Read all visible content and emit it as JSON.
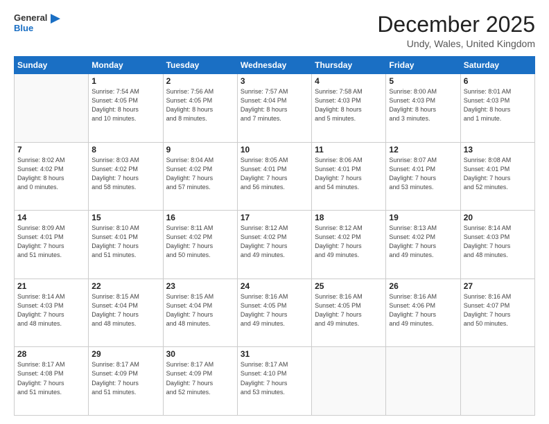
{
  "logo": {
    "line1": "General",
    "line2": "Blue"
  },
  "header": {
    "month": "December 2025",
    "location": "Undy, Wales, United Kingdom"
  },
  "weekdays": [
    "Sunday",
    "Monday",
    "Tuesday",
    "Wednesday",
    "Thursday",
    "Friday",
    "Saturday"
  ],
  "weeks": [
    [
      {
        "day": "",
        "info": ""
      },
      {
        "day": "1",
        "info": "Sunrise: 7:54 AM\nSunset: 4:05 PM\nDaylight: 8 hours\nand 10 minutes."
      },
      {
        "day": "2",
        "info": "Sunrise: 7:56 AM\nSunset: 4:05 PM\nDaylight: 8 hours\nand 8 minutes."
      },
      {
        "day": "3",
        "info": "Sunrise: 7:57 AM\nSunset: 4:04 PM\nDaylight: 8 hours\nand 7 minutes."
      },
      {
        "day": "4",
        "info": "Sunrise: 7:58 AM\nSunset: 4:03 PM\nDaylight: 8 hours\nand 5 minutes."
      },
      {
        "day": "5",
        "info": "Sunrise: 8:00 AM\nSunset: 4:03 PM\nDaylight: 8 hours\nand 3 minutes."
      },
      {
        "day": "6",
        "info": "Sunrise: 8:01 AM\nSunset: 4:03 PM\nDaylight: 8 hours\nand 1 minute."
      }
    ],
    [
      {
        "day": "7",
        "info": "Sunrise: 8:02 AM\nSunset: 4:02 PM\nDaylight: 8 hours\nand 0 minutes."
      },
      {
        "day": "8",
        "info": "Sunrise: 8:03 AM\nSunset: 4:02 PM\nDaylight: 7 hours\nand 58 minutes."
      },
      {
        "day": "9",
        "info": "Sunrise: 8:04 AM\nSunset: 4:02 PM\nDaylight: 7 hours\nand 57 minutes."
      },
      {
        "day": "10",
        "info": "Sunrise: 8:05 AM\nSunset: 4:01 PM\nDaylight: 7 hours\nand 56 minutes."
      },
      {
        "day": "11",
        "info": "Sunrise: 8:06 AM\nSunset: 4:01 PM\nDaylight: 7 hours\nand 54 minutes."
      },
      {
        "day": "12",
        "info": "Sunrise: 8:07 AM\nSunset: 4:01 PM\nDaylight: 7 hours\nand 53 minutes."
      },
      {
        "day": "13",
        "info": "Sunrise: 8:08 AM\nSunset: 4:01 PM\nDaylight: 7 hours\nand 52 minutes."
      }
    ],
    [
      {
        "day": "14",
        "info": "Sunrise: 8:09 AM\nSunset: 4:01 PM\nDaylight: 7 hours\nand 51 minutes."
      },
      {
        "day": "15",
        "info": "Sunrise: 8:10 AM\nSunset: 4:01 PM\nDaylight: 7 hours\nand 51 minutes."
      },
      {
        "day": "16",
        "info": "Sunrise: 8:11 AM\nSunset: 4:02 PM\nDaylight: 7 hours\nand 50 minutes."
      },
      {
        "day": "17",
        "info": "Sunrise: 8:12 AM\nSunset: 4:02 PM\nDaylight: 7 hours\nand 49 minutes."
      },
      {
        "day": "18",
        "info": "Sunrise: 8:12 AM\nSunset: 4:02 PM\nDaylight: 7 hours\nand 49 minutes."
      },
      {
        "day": "19",
        "info": "Sunrise: 8:13 AM\nSunset: 4:02 PM\nDaylight: 7 hours\nand 49 minutes."
      },
      {
        "day": "20",
        "info": "Sunrise: 8:14 AM\nSunset: 4:03 PM\nDaylight: 7 hours\nand 48 minutes."
      }
    ],
    [
      {
        "day": "21",
        "info": "Sunrise: 8:14 AM\nSunset: 4:03 PM\nDaylight: 7 hours\nand 48 minutes."
      },
      {
        "day": "22",
        "info": "Sunrise: 8:15 AM\nSunset: 4:04 PM\nDaylight: 7 hours\nand 48 minutes."
      },
      {
        "day": "23",
        "info": "Sunrise: 8:15 AM\nSunset: 4:04 PM\nDaylight: 7 hours\nand 48 minutes."
      },
      {
        "day": "24",
        "info": "Sunrise: 8:16 AM\nSunset: 4:05 PM\nDaylight: 7 hours\nand 49 minutes."
      },
      {
        "day": "25",
        "info": "Sunrise: 8:16 AM\nSunset: 4:05 PM\nDaylight: 7 hours\nand 49 minutes."
      },
      {
        "day": "26",
        "info": "Sunrise: 8:16 AM\nSunset: 4:06 PM\nDaylight: 7 hours\nand 49 minutes."
      },
      {
        "day": "27",
        "info": "Sunrise: 8:16 AM\nSunset: 4:07 PM\nDaylight: 7 hours\nand 50 minutes."
      }
    ],
    [
      {
        "day": "28",
        "info": "Sunrise: 8:17 AM\nSunset: 4:08 PM\nDaylight: 7 hours\nand 51 minutes."
      },
      {
        "day": "29",
        "info": "Sunrise: 8:17 AM\nSunset: 4:09 PM\nDaylight: 7 hours\nand 51 minutes."
      },
      {
        "day": "30",
        "info": "Sunrise: 8:17 AM\nSunset: 4:09 PM\nDaylight: 7 hours\nand 52 minutes."
      },
      {
        "day": "31",
        "info": "Sunrise: 8:17 AM\nSunset: 4:10 PM\nDaylight: 7 hours\nand 53 minutes."
      },
      {
        "day": "",
        "info": ""
      },
      {
        "day": "",
        "info": ""
      },
      {
        "day": "",
        "info": ""
      }
    ]
  ]
}
